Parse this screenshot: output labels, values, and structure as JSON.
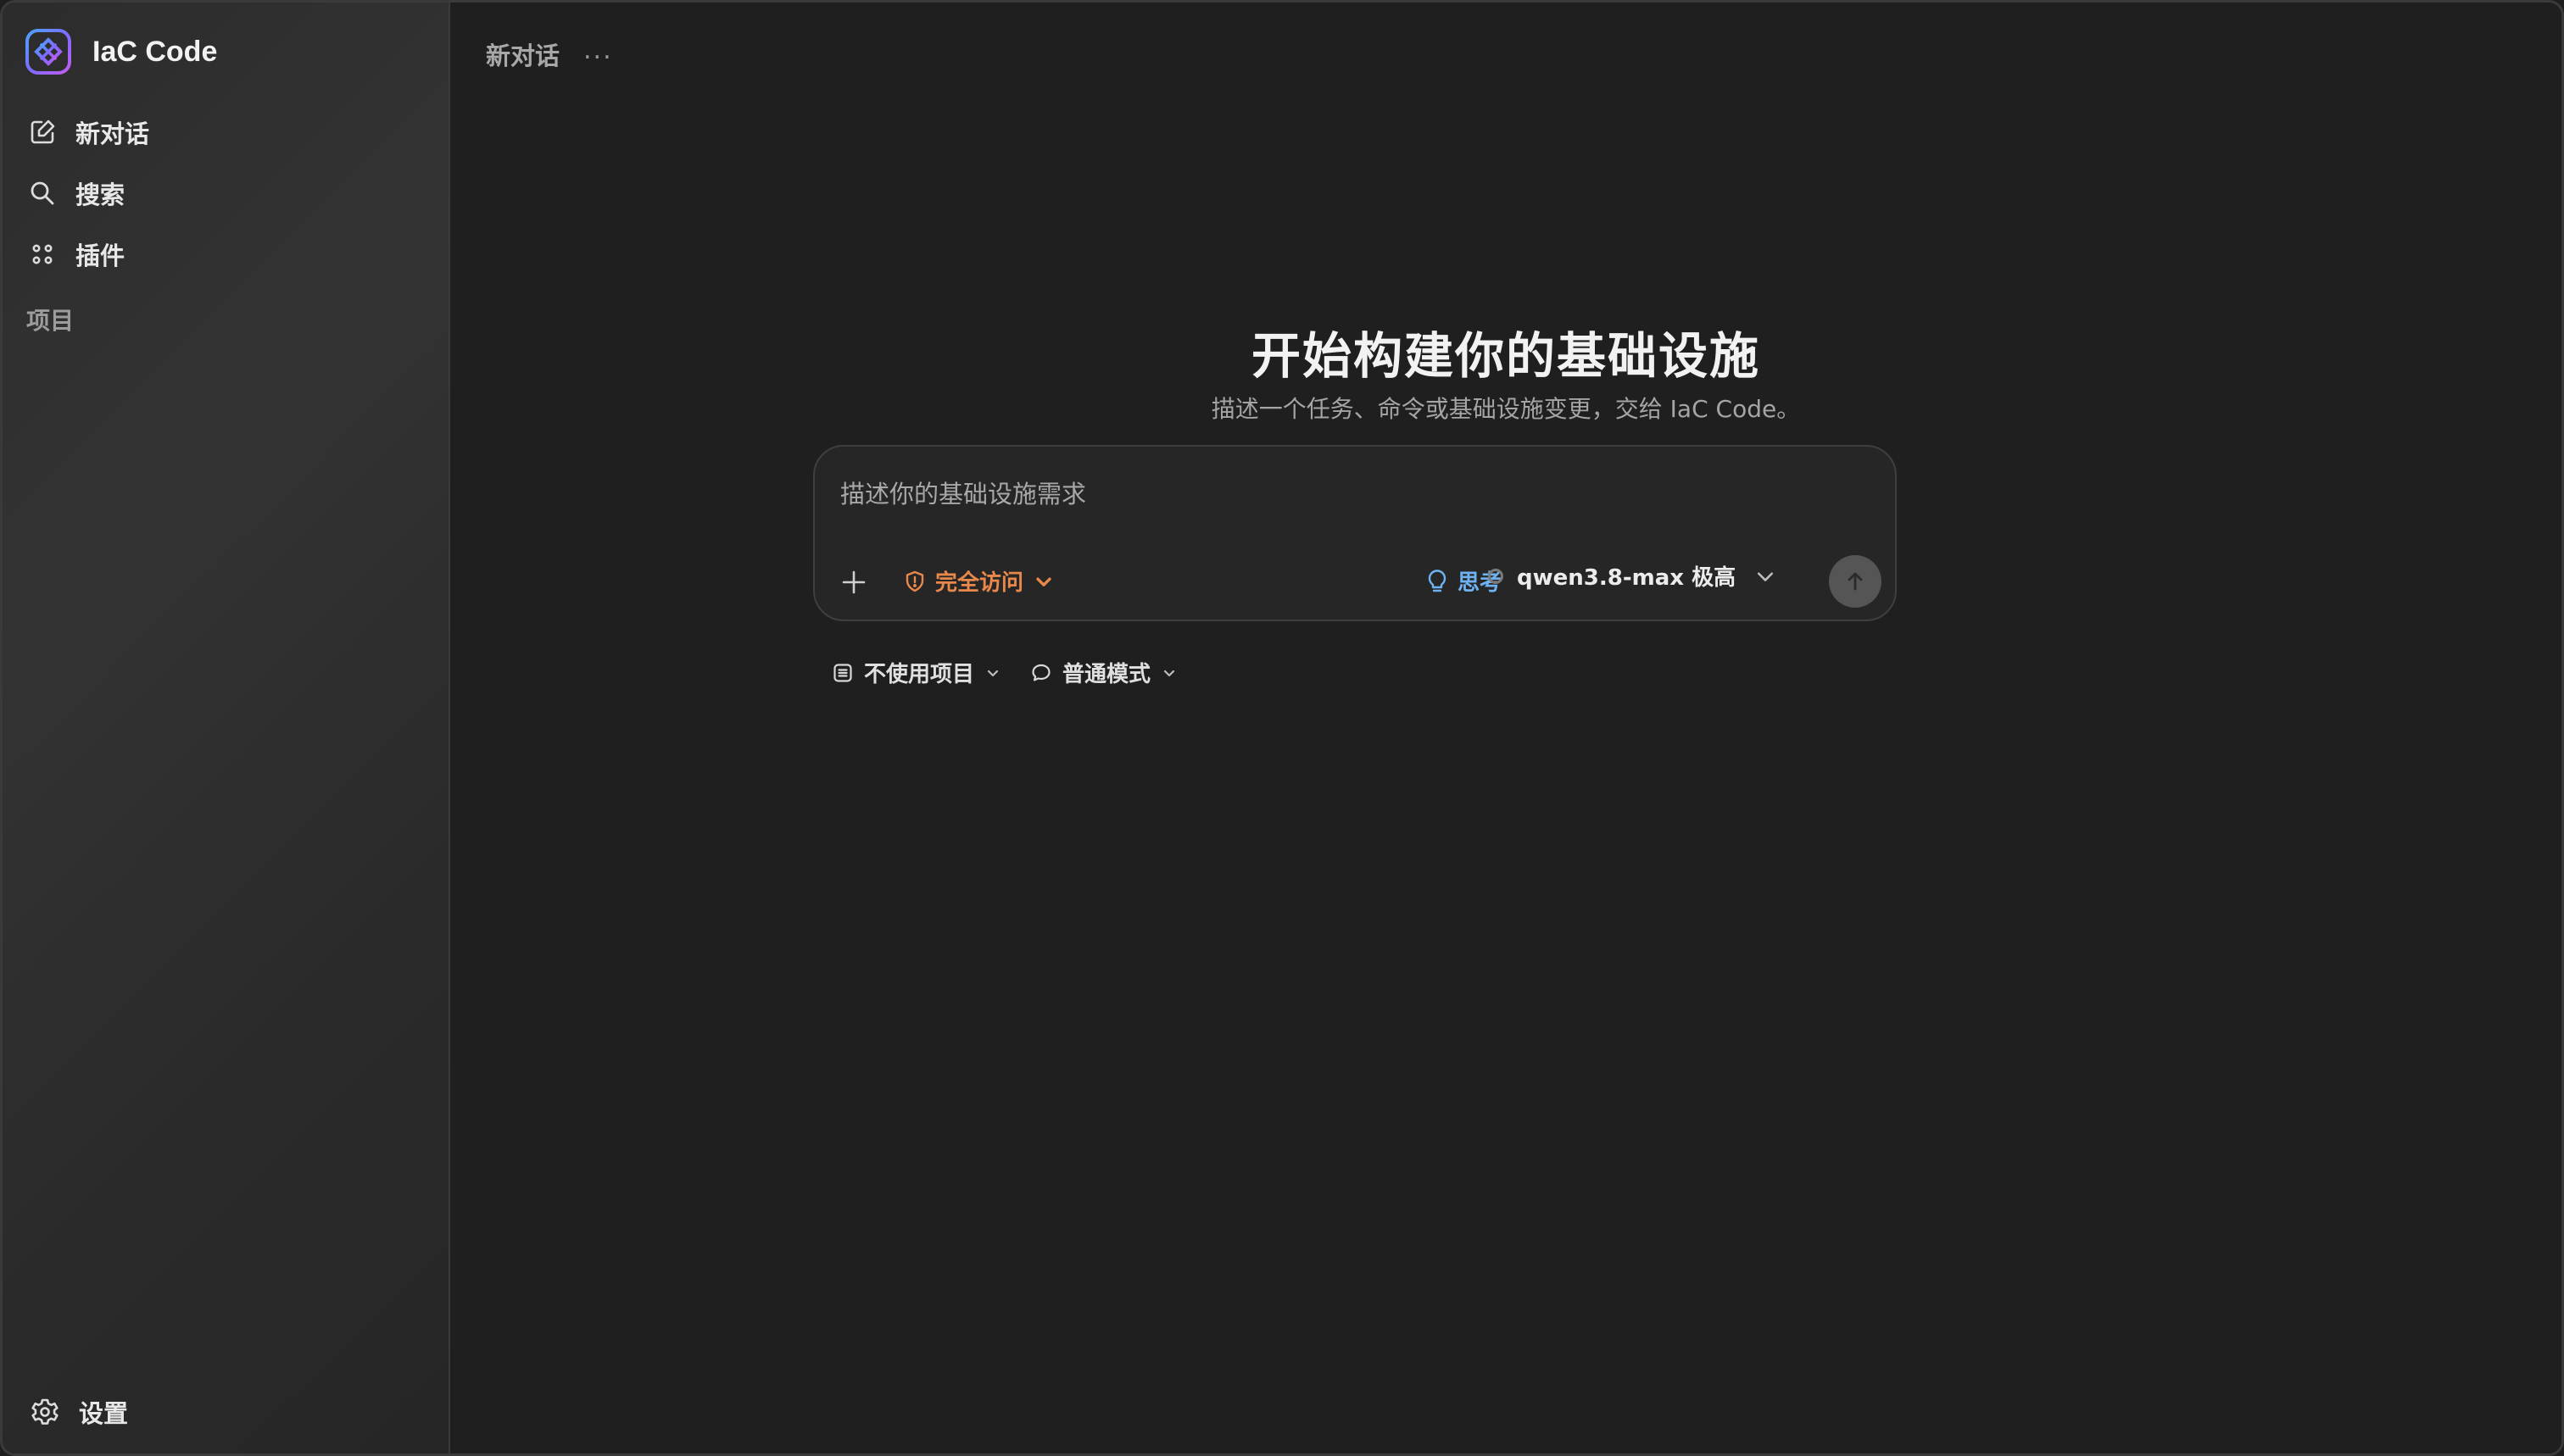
{
  "sidebar": {
    "brand": "IaC Code",
    "items": [
      {
        "label": "新对话",
        "icon": "new-chat-icon"
      },
      {
        "label": "搜索",
        "icon": "search-icon"
      },
      {
        "label": "插件",
        "icon": "plugins-icon"
      }
    ],
    "section_label": "项目",
    "settings_label": "设置"
  },
  "topbar": {
    "title": "新对话",
    "more": "..."
  },
  "hero": {
    "title": "开始构建你的基础设施",
    "subtitle": "描述一个任务、命令或基础设施变更，交给 IaC Code。"
  },
  "composer": {
    "placeholder": "描述你的基础设施需求",
    "value": "",
    "access_label": "完全访问",
    "think_label": "思考",
    "model_label": "qwen3.8-max 极高"
  },
  "chips": {
    "project_label": "不使用项目",
    "mode_label": "普通模式"
  },
  "colors": {
    "background": "#1f1f1f",
    "sidebar": "#2d2d2d",
    "access_accent": "#e8884b",
    "think_accent": "#6fb2f2",
    "send_button": "#555555"
  }
}
